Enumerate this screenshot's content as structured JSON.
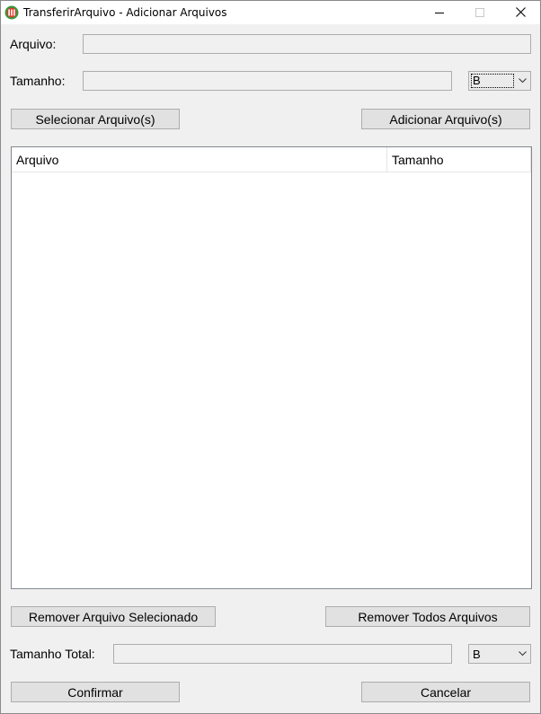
{
  "window": {
    "title": "TransferirArquivo - Adicionar Arquivos",
    "icons": {
      "app": "app-icon",
      "minimize": "minimize-icon",
      "maximize": "maximize-icon",
      "close": "close-icon"
    }
  },
  "form": {
    "arquivo_label": "Arquivo:",
    "arquivo_value": "",
    "tamanho_label": "Tamanho:",
    "tamanho_value": "",
    "tamanho_unit": "B"
  },
  "buttons": {
    "select_files": "Selecionar Arquivo(s)",
    "add_files": "Adicionar Arquivo(s)",
    "remove_selected": "Remover Arquivo Selecionado",
    "remove_all": "Remover Todos Arquivos",
    "confirm": "Confirmar",
    "cancel": "Cancelar"
  },
  "list": {
    "columns": [
      "Arquivo",
      "Tamanho"
    ],
    "rows": []
  },
  "total": {
    "label": "Tamanho Total:",
    "value": "",
    "unit": "B"
  },
  "colors": {
    "window_bg": "#f0f0f0",
    "button_bg": "#e1e1e1",
    "border": "#adadad"
  }
}
